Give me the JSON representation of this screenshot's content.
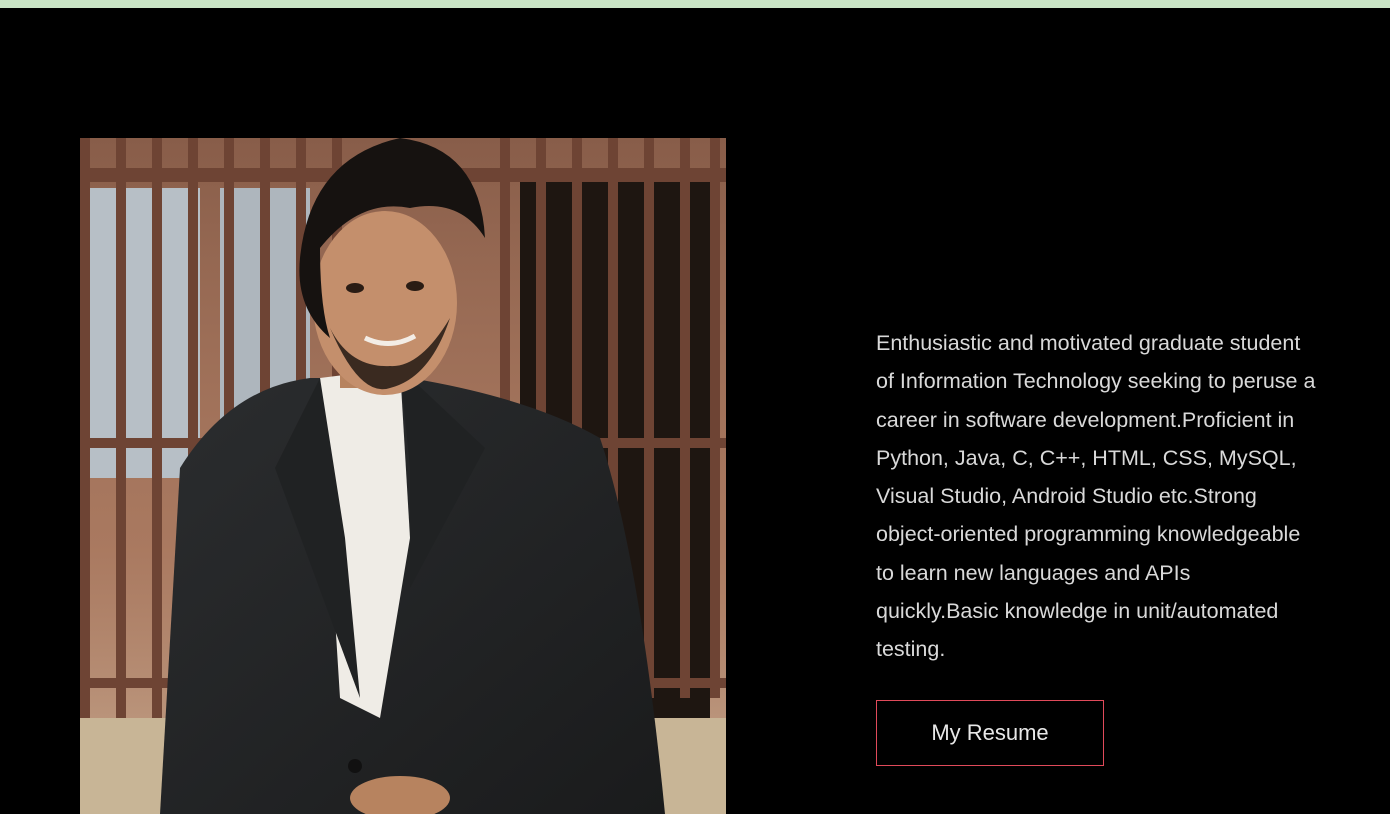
{
  "colors": {
    "page_background": "#000000",
    "top_strip": "#c9e4c5",
    "bio_text": "#d9d9d9",
    "button_border": "#e04a5a",
    "button_text": "#e8e8e8"
  },
  "about": {
    "photo_icon": "profile-photo",
    "bio": "Enthusiastic and motivated graduate student of Information Technology seeking to peruse a career in software development.Proficient in Python, Java, C, C++, HTML, CSS, MySQL, Visual Studio, Android Studio etc.Strong object-oriented programming knowledgeable to learn new languages and APIs quickly.Basic knowledge in unit/automated testing.",
    "resume_button_label": "My Resume"
  }
}
